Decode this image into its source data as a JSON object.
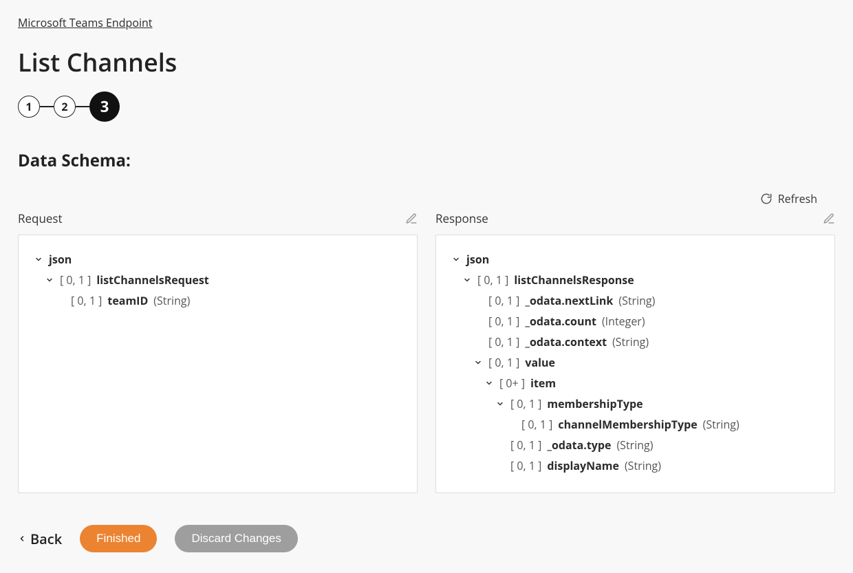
{
  "breadcrumb": "Microsoft Teams Endpoint",
  "page_title": "List Channels",
  "stepper": {
    "steps": [
      "1",
      "2",
      "3"
    ],
    "active_index": 2
  },
  "section_title": "Data Schema:",
  "refresh_label": "Refresh",
  "columns": {
    "request": {
      "title": "Request"
    },
    "response": {
      "title": "Response"
    }
  },
  "request_tree": [
    {
      "indent": 0,
      "caret": true,
      "card": "",
      "name": "json",
      "ptype": ""
    },
    {
      "indent": 1,
      "caret": true,
      "card": "[ 0, 1 ]",
      "name": "listChannelsRequest",
      "ptype": ""
    },
    {
      "indent": 2,
      "caret": false,
      "card": "[ 0, 1 ]",
      "name": "teamID",
      "ptype": "(String)"
    }
  ],
  "response_tree": [
    {
      "indent": 0,
      "caret": true,
      "card": "",
      "name": "json",
      "ptype": ""
    },
    {
      "indent": 1,
      "caret": true,
      "card": "[ 0, 1 ]",
      "name": "listChannelsResponse",
      "ptype": ""
    },
    {
      "indent": 2,
      "caret": false,
      "card": "[ 0, 1 ]",
      "name": "_odata.nextLink",
      "ptype": "(String)"
    },
    {
      "indent": 2,
      "caret": false,
      "card": "[ 0, 1 ]",
      "name": "_odata.count",
      "ptype": "(Integer)"
    },
    {
      "indent": 2,
      "caret": false,
      "card": "[ 0, 1 ]",
      "name": "_odata.context",
      "ptype": "(String)"
    },
    {
      "indent": 2,
      "caret": true,
      "card": "[ 0, 1 ]",
      "name": "value",
      "ptype": ""
    },
    {
      "indent": 3,
      "caret": true,
      "card": "[ 0+ ]",
      "name": "item",
      "ptype": ""
    },
    {
      "indent": 4,
      "caret": true,
      "card": "[ 0, 1 ]",
      "name": "membershipType",
      "ptype": ""
    },
    {
      "indent": 5,
      "caret": false,
      "card": "[ 0, 1 ]",
      "name": "channelMembershipType",
      "ptype": "(String)"
    },
    {
      "indent": 4,
      "caret": false,
      "card": "[ 0, 1 ]",
      "name": "_odata.type",
      "ptype": "(String)"
    },
    {
      "indent": 4,
      "caret": false,
      "card": "[ 0, 1 ]",
      "name": "displayName",
      "ptype": "(String)"
    }
  ],
  "footer": {
    "back": "Back",
    "finished": "Finished",
    "discard": "Discard Changes"
  }
}
